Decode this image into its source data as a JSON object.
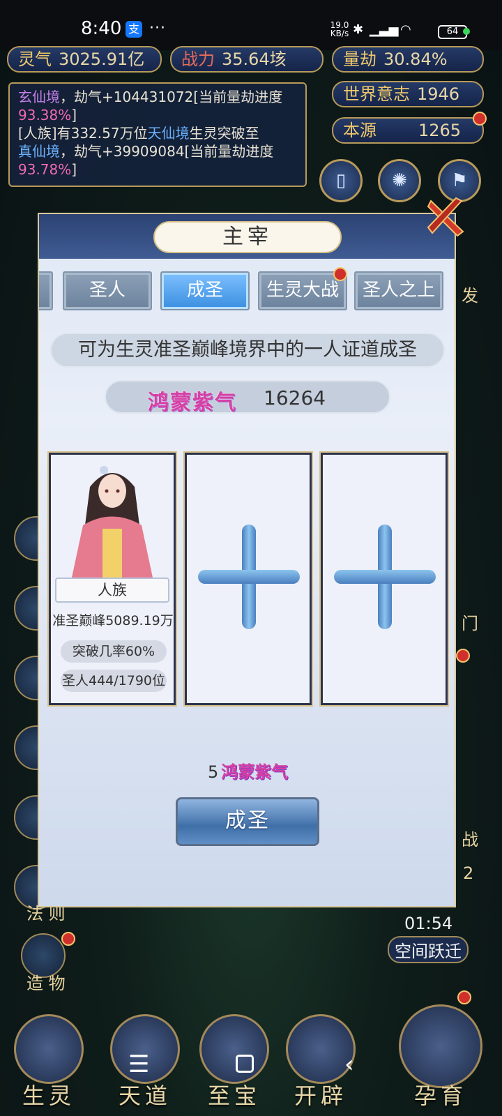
{
  "status_bar": {
    "time": "8:40",
    "alipay": "支",
    "dots": "···",
    "speed_value": "19.0",
    "speed_unit": "KB/s",
    "battery": "64"
  },
  "stats": {
    "lingqi_label": "灵气",
    "lingqi_value": "3025.91亿",
    "zhanli_label": "战力",
    "zhanli_value": "35.64垓",
    "liangjie_label": "量劫",
    "liangjie_value": "30.84%",
    "shijie_label": "世界意志",
    "shijie_value": "1946",
    "benyuan_label": "本源",
    "benyuan_value": "1265"
  },
  "notice": {
    "l1_realm": "玄仙境",
    "l1_text": "，劫气+104431072[当前量劫进度",
    "l1_pct": "93.38%",
    "l1_end": "]",
    "l2_start": "[人族]有332.57万位",
    "l2_realm": "天仙境",
    "l2_mid": "生灵突破至",
    "l3_realm": "真仙境",
    "l3_text": "，劫气+39909084[当前量劫进度",
    "l3_pct": "93.78%",
    "l3_end": "]"
  },
  "side_labels": {
    "right_fa": "发",
    "right_men": "门",
    "right_zhan": "战",
    "right_num": "2",
    "timer": "01:54",
    "space_jump": "空间跃迁",
    "left_fa_ze": "法 则",
    "left_zao_wu": "造 物"
  },
  "dialog": {
    "title": "主宰",
    "tabs": [
      {
        "label": "圣人"
      },
      {
        "label": "成圣"
      },
      {
        "label": "生灵大战"
      },
      {
        "label": "圣人之上"
      }
    ],
    "description": "可为生灵准圣巅峰境界中的一人证道成圣",
    "currency_name": "鸿蒙紫气",
    "currency_value": "16264",
    "slot1": {
      "race": "人族",
      "realm_count": "准圣巅峰5089.19万",
      "breakthrough": "突破几率60%",
      "saints": "圣人444/1790位"
    },
    "cost_amount": "5",
    "cost_currency": "鸿蒙紫气",
    "action_label": "成圣"
  },
  "bottom_nav": [
    {
      "label": "生灵"
    },
    {
      "label": "天道"
    },
    {
      "label": "至宝"
    },
    {
      "label": "开辟"
    },
    {
      "label": "孕育"
    }
  ],
  "colors": {
    "accent_gold": "#b89a5a",
    "active_tab": "#3a8fe0",
    "currency_pink": "#d63fa3",
    "progress_pink": "#f06ab0"
  }
}
